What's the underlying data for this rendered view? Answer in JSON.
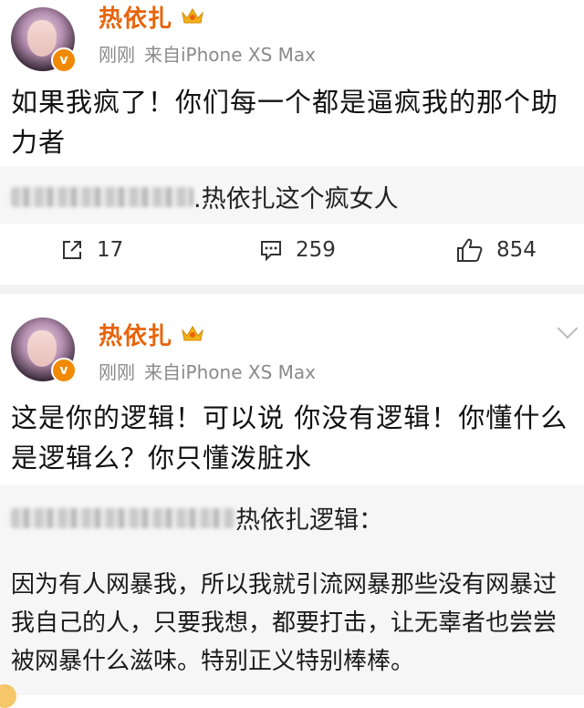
{
  "posts": [
    {
      "author": "热依扎",
      "time": "刚刚",
      "source": "来自iPhone XS Max",
      "text": "如果我疯了！你们每一个都是逼疯我的那个助力者",
      "quote_text": ".热依扎这个疯女人",
      "repost_count": "17",
      "comment_count": "259",
      "like_count": "854"
    },
    {
      "author": "热依扎",
      "time": "刚刚",
      "source": "来自iPhone XS Max",
      "text": "这是你的逻辑！可以说 你没有逻辑！你懂什么是逻辑么？你只懂泼脏水",
      "quote_text": "热依扎逻辑：",
      "quote_body": "因为有人网暴我，所以我就引流网暴那些没有网暴过我自己的人，只要我想，都要打击，让无辜者也尝尝被网暴什么滋味。特别正义特别棒棒。"
    }
  ],
  "icons": {
    "verified": "verified-badge-icon",
    "crown": "crown-icon",
    "repost": "repost-icon",
    "comment": "comment-icon",
    "like": "like-icon",
    "menu": "chevron-down-icon"
  },
  "colors": {
    "author": "#e8630a",
    "meta": "#8a8a8a",
    "verified": "#f08a00"
  }
}
